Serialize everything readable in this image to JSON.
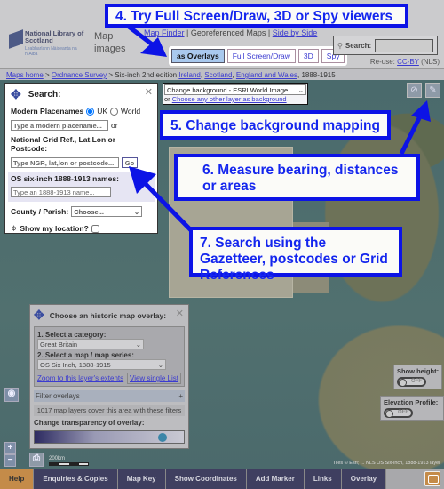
{
  "header": {
    "logo_line1": "National Library of Scotland",
    "logo_line2": "Leabharlann Nàiseanta na h-Alba",
    "section": "Map images",
    "nav": [
      {
        "label": "Map Finder",
        "link": true
      },
      {
        "label": "Georeferenced Maps",
        "link": false
      },
      {
        "label": "Side by Side",
        "link": true
      }
    ],
    "view_tabs": [
      {
        "label": "as Overlays",
        "active": true
      },
      {
        "label": "Full Screen/Draw"
      },
      {
        "label": "3D"
      },
      {
        "label": "Spy"
      }
    ],
    "search_label": "Search:",
    "reuse_prefix": "Re-use:",
    "reuse_link": "CC-BY",
    "reuse_suffix": "(NLS)"
  },
  "breadcrumb": {
    "items": [
      "Maps home",
      "Ordnance Survey"
    ],
    "current": "Six-inch 2nd edition",
    "links": [
      "Ireland",
      "Scotland",
      "England and Wales"
    ],
    "dates": "1888-1915"
  },
  "search_panel": {
    "title": "Search:",
    "modern_label": "Modern Placenames",
    "radio_uk": "UK",
    "radio_world": "World",
    "modern_placeholder": "Type a modern placename...",
    "or": "or",
    "ngr_label": "National Grid Ref., Lat,Lon or Postcode:",
    "ngr_placeholder": "Type NGR, lat,lon or postcode...",
    "go": "Go",
    "os_label": "OS six-inch 1888-1913 names:",
    "os_placeholder": "Type an 1888-1913 name...",
    "county_label": "County / Parish:",
    "county_value": "Choose...",
    "location_label": "Show my location?"
  },
  "background": {
    "select_value": "Change background - ESRI World Image",
    "or": "or",
    "link": "Choose any other layer as background"
  },
  "overlay_panel": {
    "title": "Choose an historic map overlay:",
    "category_label": "1. Select a category:",
    "category_value": "Great Britain",
    "series_label": "2. Select a map / map series:",
    "series_value": "OS Six Inch, 1888-1915",
    "zoom_link": "Zoom to this layer's extents",
    "view_list": "View single List",
    "filter": "Filter overlays",
    "filter_icon": "+",
    "count_text": "1017 map layers cover this area with these filters",
    "transparency_label": "Change transparency of overlay:",
    "transparency_value": 0.9
  },
  "show_height": {
    "label": "Show height:",
    "state": "OFF"
  },
  "elevation": {
    "label": "Elevation Profile:",
    "state": "OFF"
  },
  "scale": "200km",
  "attribution": "Tiles © Esri; ... NLS OS Six-inch, 1888-1913 layer",
  "bottom_tabs": [
    "Help",
    "Enquiries & Copies",
    "Map Key",
    "Show Coordinates",
    "Add Marker",
    "Links",
    "Overlay"
  ],
  "callouts": {
    "c4": "4. Try Full Screen/Draw, 3D or Spy viewers",
    "c5": "5. Change background mapping",
    "c6": "6. Measure bearing, distances or areas",
    "c7": "7. Search using the Gazetteer, postcodes or Grid References"
  },
  "colors": {
    "callout": "#0c13e6",
    "help_tab": "#c48b49",
    "tabs": "#3f3f60"
  }
}
